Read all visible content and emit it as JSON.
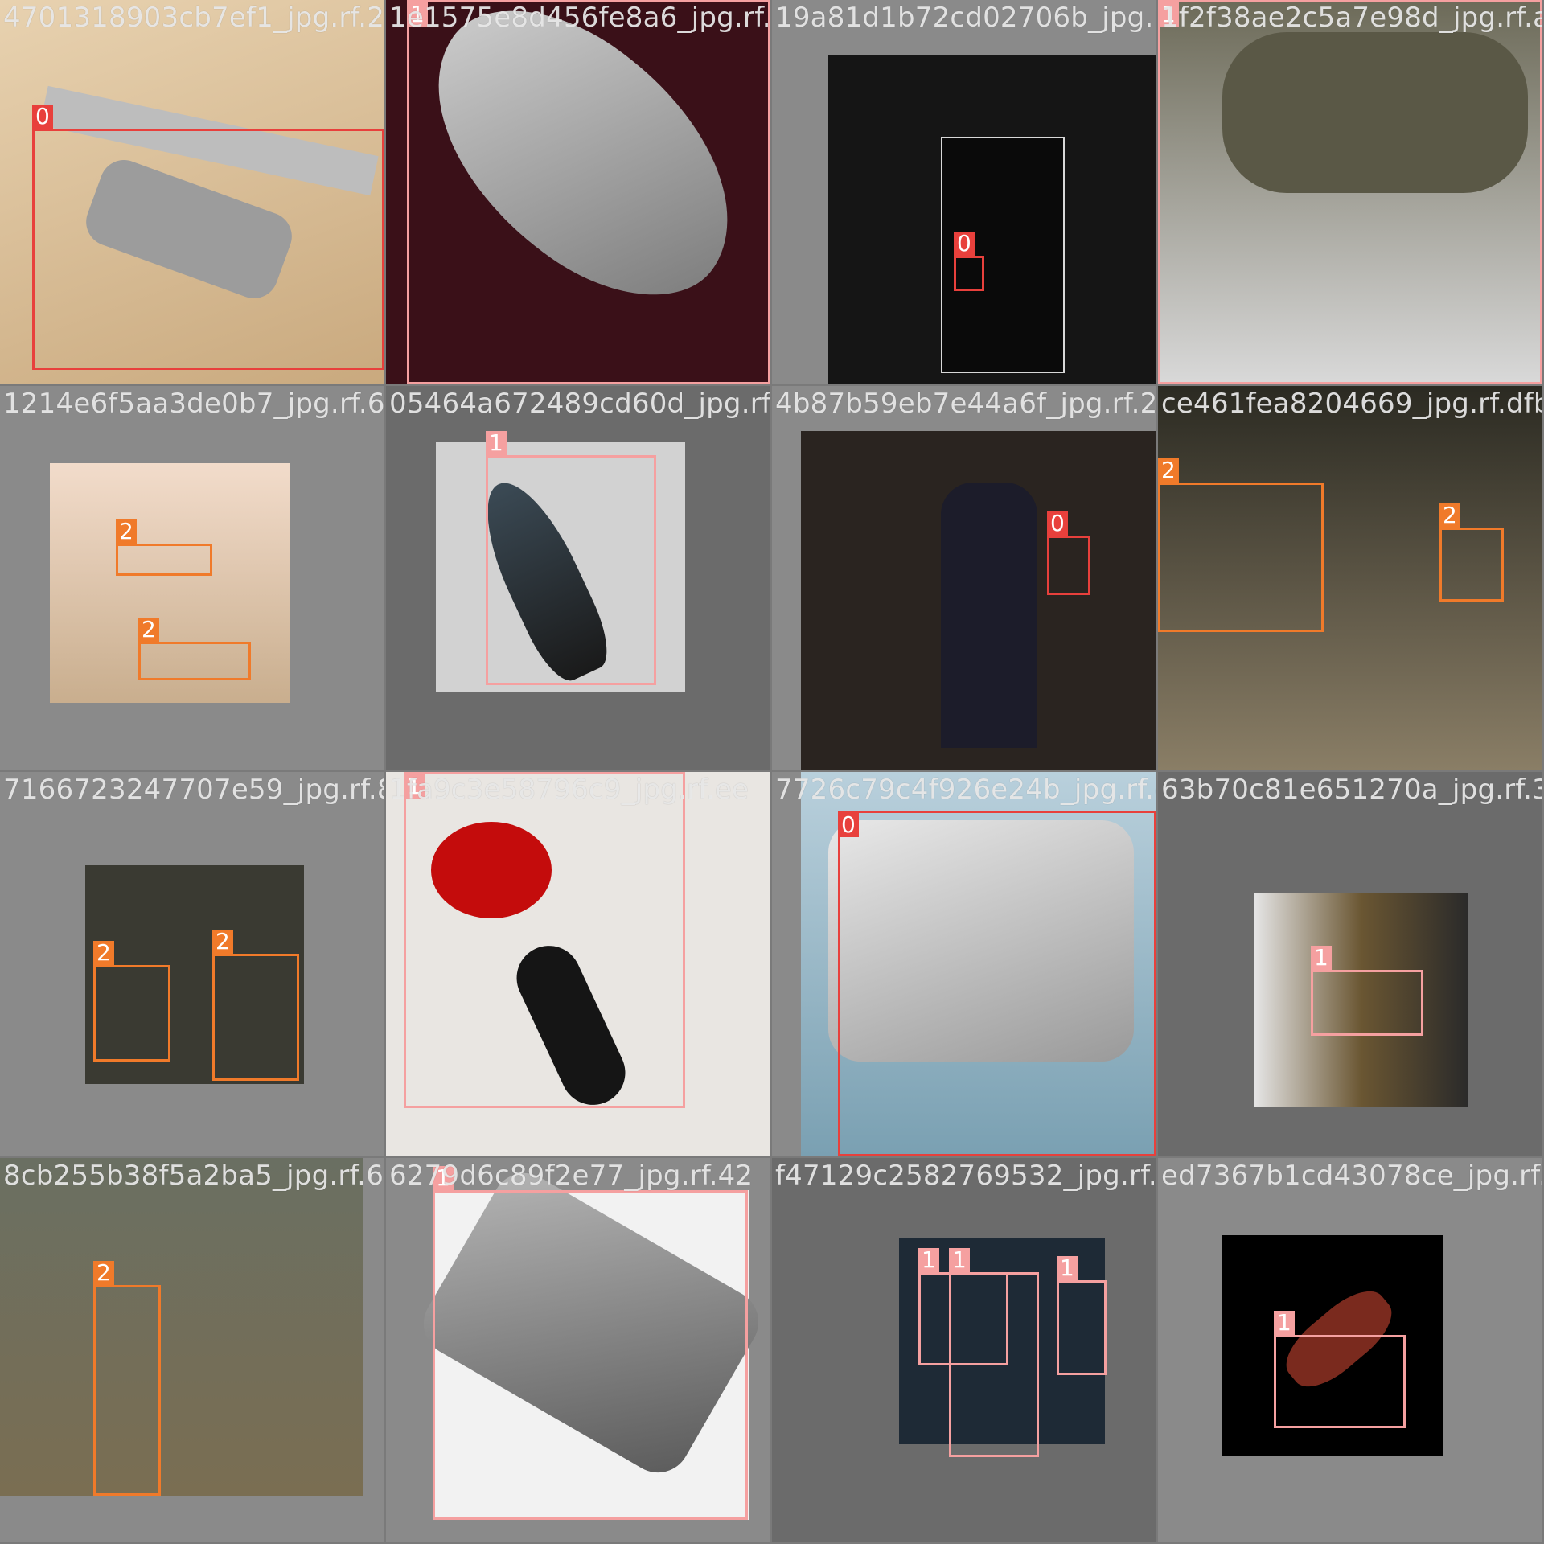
{
  "palette": {
    "class0": "#e8403c",
    "class1": "#f5a0a0",
    "class2": "#f07a2a"
  },
  "tiles": [
    {
      "filename": "4701318903cb7ef1_jpg.rf.2"
    },
    {
      "filename": "1e1575e8d456fe8a6_jpg.rf.e3"
    },
    {
      "filename": "19a81d1b72cd02706b_jpg.rf.e1"
    },
    {
      "filename": "1f2f38ae2c5a7e98d_jpg.rf.a5"
    },
    {
      "filename": "1214e6f5aa3de0b7_jpg.rf.68"
    },
    {
      "filename": "05464a672489cd60d_jpg.rf.3"
    },
    {
      "filename": "4b87b59eb7e44a6f_jpg.rf.28"
    },
    {
      "filename": "ce461fea8204669_jpg.rf.dfb"
    },
    {
      "filename": "7166723247707e59_jpg.rf.81"
    },
    {
      "filename": "1fa9c3e58796c9_jpg.rf.ee"
    },
    {
      "filename": "7726c79c4f926e24b_jpg.rf.c5"
    },
    {
      "filename": "63b70c81e651270a_jpg.rf.3"
    },
    {
      "filename": "8cb255b38f5a2ba5_jpg.rf.6d"
    },
    {
      "filename": "6279d6c89f2e77_jpg.rf.42"
    },
    {
      "filename": "f47129c2582769532_jpg.rf.4a"
    },
    {
      "filename": "ed7367b1cd43078ce_jpg.rf.2"
    }
  ],
  "labels": {
    "c0": "0",
    "c1": "1",
    "c2": "2"
  }
}
